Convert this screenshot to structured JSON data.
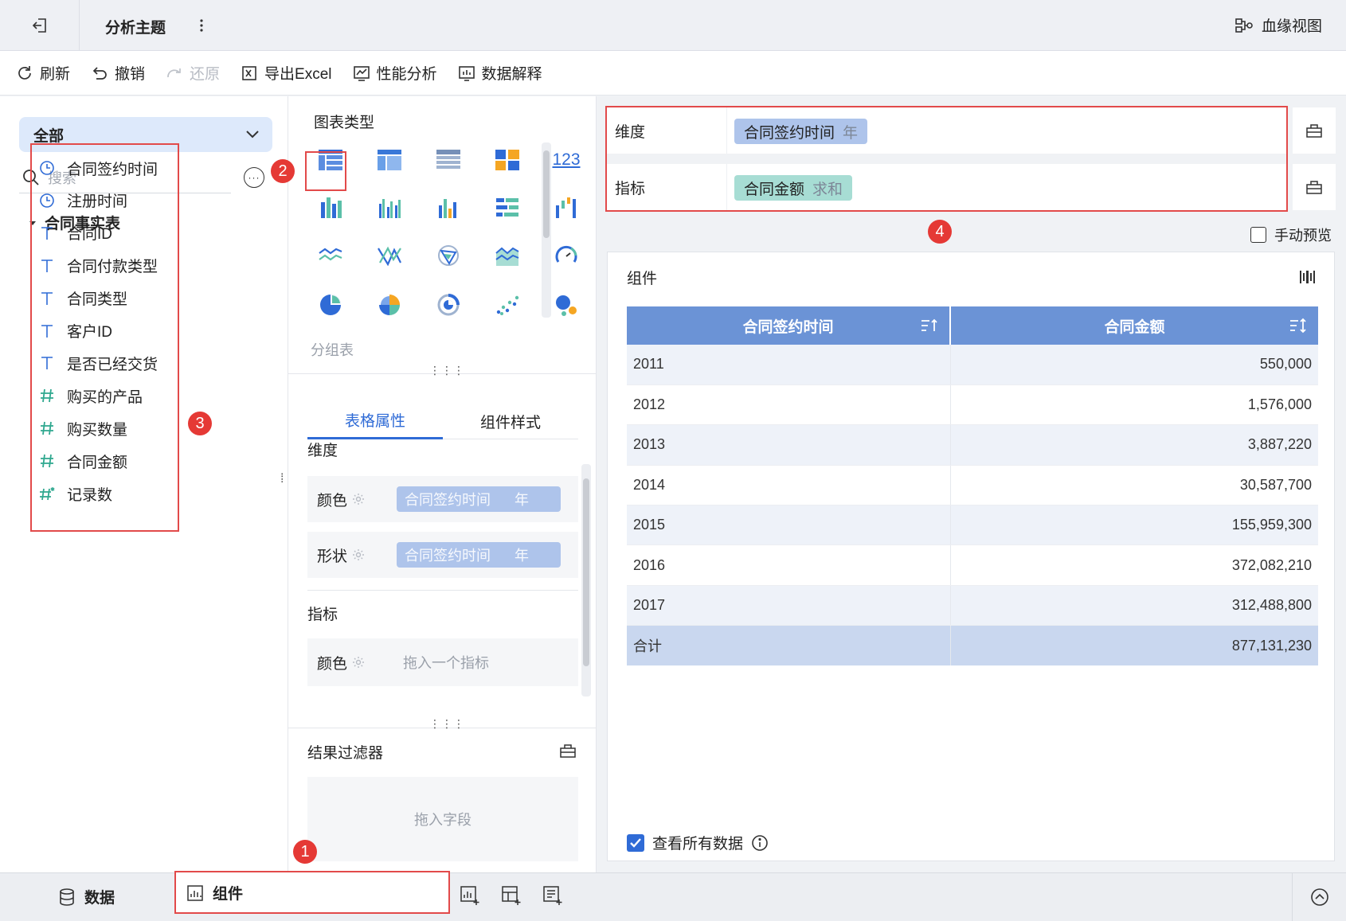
{
  "header": {
    "title": "分析主题",
    "lineage_label": "血缘视图"
  },
  "toolbar": {
    "refresh": "刷新",
    "undo": "撤销",
    "redo": "还原",
    "export": "导出Excel",
    "perf": "性能分析",
    "explain": "数据解释"
  },
  "left": {
    "dataset_select": "全部",
    "search_placeholder": "搜索",
    "table_name": "合同事实表",
    "fields": [
      {
        "label": "合同签约时间",
        "type": "time"
      },
      {
        "label": "注册时间",
        "type": "time"
      },
      {
        "label": "合同ID",
        "type": "text"
      },
      {
        "label": "合同付款类型",
        "type": "text"
      },
      {
        "label": "合同类型",
        "type": "text"
      },
      {
        "label": "客户ID",
        "type": "text"
      },
      {
        "label": "是否已经交货",
        "type": "text"
      },
      {
        "label": "购买的产品",
        "type": "number"
      },
      {
        "label": "购买数量",
        "type": "number"
      },
      {
        "label": "合同金额",
        "type": "number"
      },
      {
        "label": "记录数",
        "type": "number-star"
      }
    ]
  },
  "middle": {
    "chart_type_title": "图表类型",
    "chart_123_label": "123",
    "group_table_label": "分组表",
    "tabs": [
      "表格属性",
      "组件样式"
    ],
    "dim_section": "维度",
    "color_label": "颜色",
    "shape_label": "形状",
    "pill_field": "合同签约时间",
    "pill_unit": "年",
    "metric_section": "指标",
    "metric_color_label": "颜色",
    "metric_placeholder": "拖入一个指标",
    "filter_title": "结果过滤器",
    "filter_placeholder": "拖入字段"
  },
  "right": {
    "dim_label": "维度",
    "dim_tag": "合同签约时间",
    "dim_tag_unit": "年",
    "metric_label": "指标",
    "metric_tag": "合同金额",
    "metric_tag_unit": "求和",
    "manual_preview": "手动预览",
    "widget_title": "组件",
    "table": {
      "headers": [
        "合同签约时间",
        "合同金额"
      ],
      "rows": [
        [
          "2011",
          "550,000"
        ],
        [
          "2012",
          "1,576,000"
        ],
        [
          "2013",
          "3,887,220"
        ],
        [
          "2014",
          "30,587,700"
        ],
        [
          "2015",
          "155,959,300"
        ],
        [
          "2016",
          "372,082,210"
        ],
        [
          "2017",
          "312,488,800"
        ]
      ],
      "total": [
        "合计",
        "877,131,230"
      ]
    },
    "view_all": "查看所有数据"
  },
  "bottom": {
    "data_tab": "数据",
    "component_tab": "组件"
  },
  "badges": [
    "1",
    "2",
    "3",
    "4"
  ],
  "colors": {
    "accent": "#2f6bd6",
    "header_blue": "#6b93d6",
    "dim_tag_bg": "#aec4eb",
    "metric_tag_bg": "#a7ddd4",
    "annotation_red": "#e24a4a",
    "badge_red": "#e53935"
  }
}
